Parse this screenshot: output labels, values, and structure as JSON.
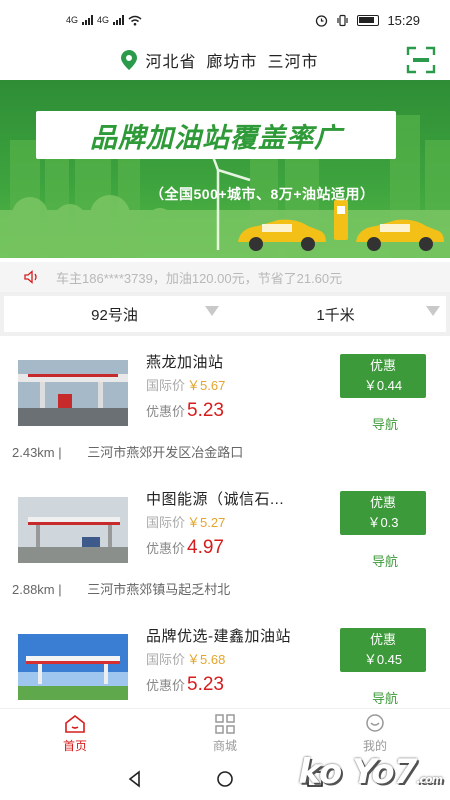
{
  "status_bar": {
    "network_1": "4G",
    "network_2": "4G",
    "time": "15:29"
  },
  "location": {
    "province": "河北省",
    "city": "廊坊市",
    "district": "三河市"
  },
  "banner": {
    "title": "品牌加油站覆盖率广",
    "subtitle": "（全国500+城市、8万+油站适用）"
  },
  "notice": {
    "text": "车主186****3739，加油120.00元，节省了21.60元"
  },
  "filters": {
    "fuel": "92号油",
    "distance": "1千米"
  },
  "stations": [
    {
      "name": "燕龙加油站",
      "intl_label": "国际价",
      "intl_price": "￥5.67",
      "disc_label": "优惠价",
      "disc_price": "5.23",
      "promo_label": "优惠",
      "promo_value": "￥0.44",
      "nav_label": "导航",
      "distance": "2.43km",
      "separator": "|",
      "address": "三河市燕郊开发区冶金路口"
    },
    {
      "name": "中图能源（诚信石...",
      "intl_label": "国际价",
      "intl_price": "￥5.27",
      "disc_label": "优惠价",
      "disc_price": "4.97",
      "promo_label": "优惠",
      "promo_value": "￥0.3",
      "nav_label": "导航",
      "distance": "2.88km",
      "separator": "|",
      "address": "三河市燕郊镇马起乏村北"
    },
    {
      "name": "品牌优选-建鑫加油站",
      "intl_label": "国际价",
      "intl_price": "￥5.68",
      "disc_label": "优惠价",
      "disc_price": "5.23",
      "promo_label": "优惠",
      "promo_value": "￥0.45",
      "nav_label": "导航",
      "distance": "",
      "separator": "",
      "address": ""
    }
  ],
  "tabs": [
    {
      "label": "首页",
      "icon": "home-icon",
      "active": true
    },
    {
      "label": "商城",
      "icon": "grid-icon",
      "active": false
    },
    {
      "label": "我的",
      "icon": "user-icon",
      "active": false
    }
  ],
  "watermark": {
    "text": "ko Yo7",
    "suffix": ".com"
  },
  "colors": {
    "brand_green": "#3d9a3a",
    "price_red": "#d61d1d",
    "intl_price_gold": "#e3a52d",
    "active_tab": "#d61d1d"
  }
}
